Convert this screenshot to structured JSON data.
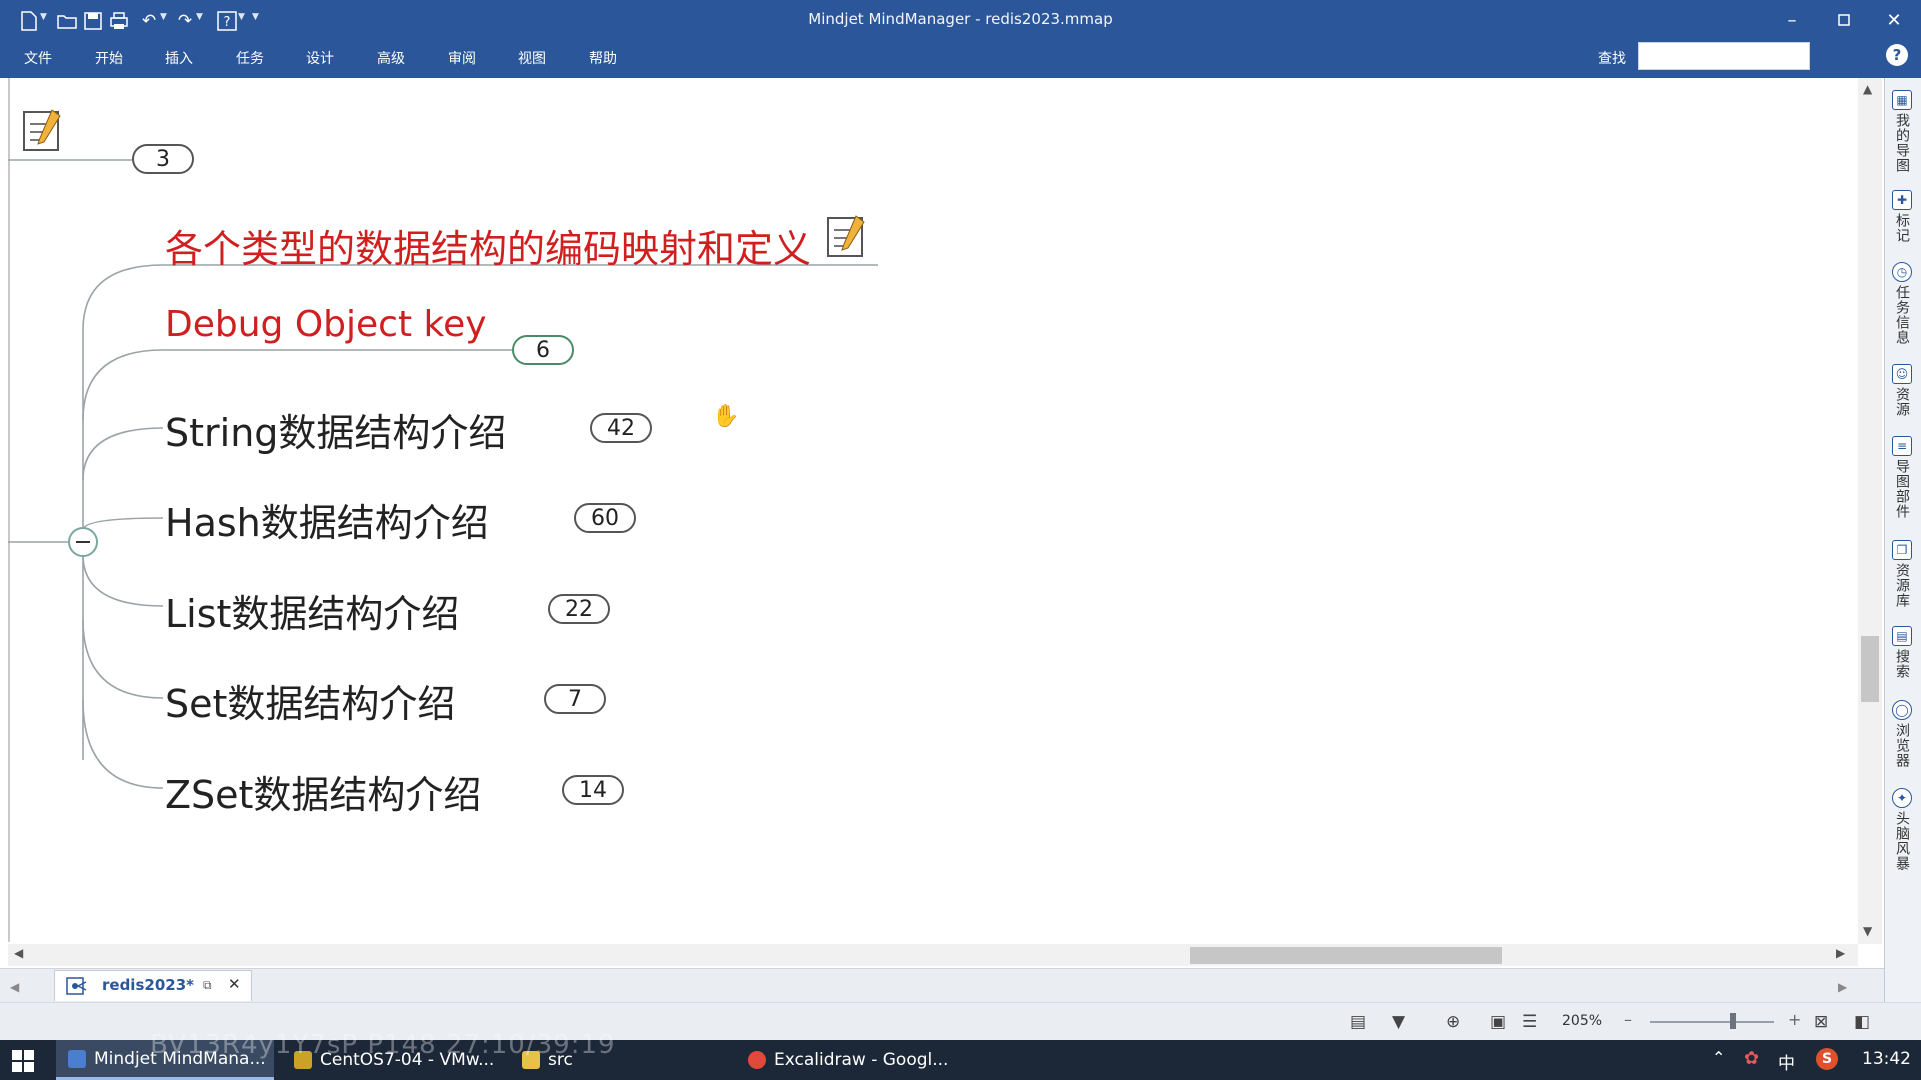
{
  "window": {
    "title": "Mindjet MindManager - redis2023.mmap"
  },
  "menu": {
    "tabs": [
      "文件",
      "开始",
      "插入",
      "任务",
      "设计",
      "高级",
      "审阅",
      "视图",
      "帮助"
    ]
  },
  "search": {
    "label": "查找"
  },
  "map": {
    "top_badge": "3",
    "topics": [
      {
        "label": "各个类型的数据结构的编码映射和定义",
        "badge": ""
      },
      {
        "label": "Debug Object key",
        "badge": "6"
      },
      {
        "label": "String数据结构介绍",
        "badge": "42"
      },
      {
        "label": "Hash数据结构介绍",
        "badge": "60"
      },
      {
        "label": "List数据结构介绍",
        "badge": "22"
      },
      {
        "label": "Set数据结构介绍",
        "badge": "7"
      },
      {
        "label": "ZSet数据结构介绍",
        "badge": "14"
      }
    ]
  },
  "right_panel": {
    "items": [
      "我的导图",
      "标记",
      "任务信息",
      "资源",
      "导图部件",
      "资源库",
      "搜索",
      "浏览器",
      "头脑风暴"
    ]
  },
  "document_tab": {
    "name": "redis2023*"
  },
  "status": {
    "zoom": "205%"
  },
  "taskbar": {
    "items": [
      "Mindjet MindMana...",
      "CentOS7-04 - VMw...",
      "src",
      "Excalidraw - Googl..."
    ],
    "ime": "中",
    "time": "13:42"
  },
  "overlay": {
    "watermark": "BV13R4y1Y7sP P148 27:10/39:19"
  },
  "colors": {
    "ribbon": "#2b579a",
    "topic_red": "#d01f1f",
    "taskbar": "#1c2738"
  }
}
